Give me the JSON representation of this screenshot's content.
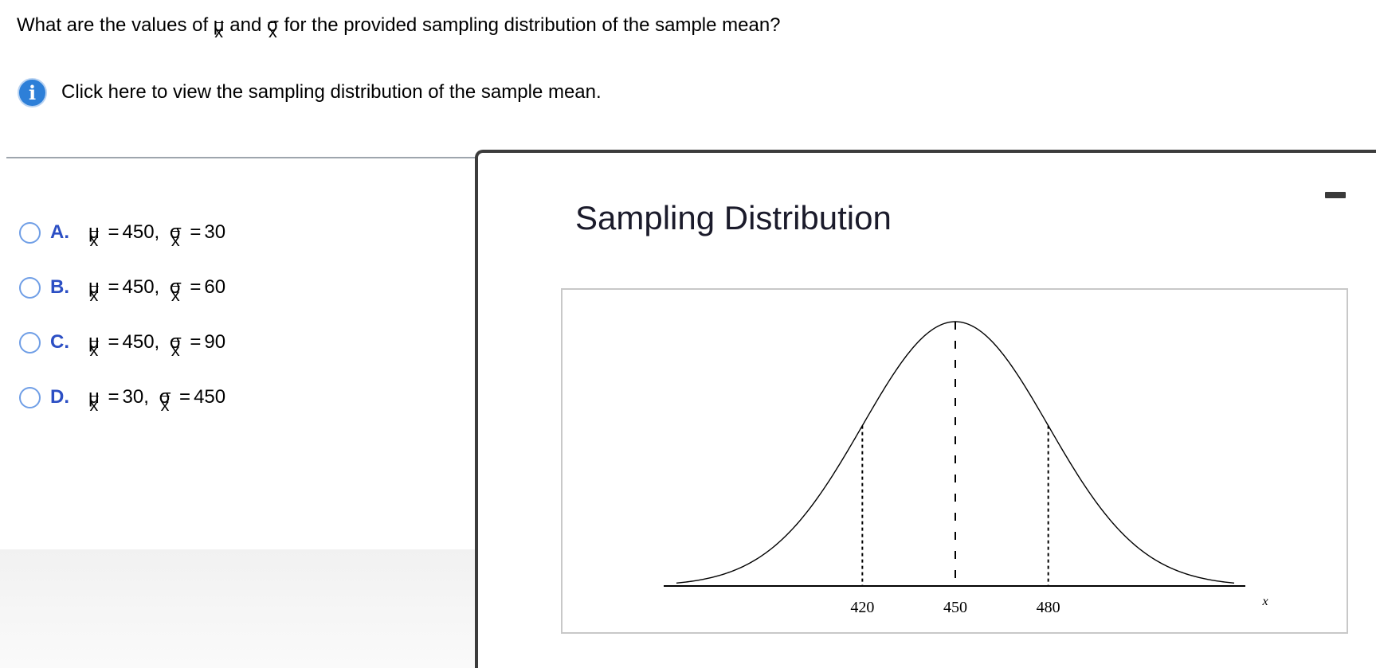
{
  "question": {
    "prefix": "What are the values of ",
    "mu": "μ",
    "sigma": "σ",
    "sub": "x",
    "mid": " and ",
    "suffix": " for the provided sampling distribution of the sample mean?"
  },
  "info": {
    "icon": "info-icon",
    "icon_glyph": "i",
    "link_text": "Click here to view the sampling distribution of the sample mean."
  },
  "options": [
    {
      "letter": "A.",
      "mu_value": "450,",
      "sigma_value": "30"
    },
    {
      "letter": "B.",
      "mu_value": "450,",
      "sigma_value": "60"
    },
    {
      "letter": "C.",
      "mu_value": "450,",
      "sigma_value": "90"
    },
    {
      "letter": "D.",
      "mu_value": "30,",
      "sigma_value": "450"
    }
  ],
  "symbols": {
    "mu": "μ",
    "sigma": "σ",
    "sub": "x",
    "equals": "="
  },
  "popup": {
    "title": "Sampling Distribution",
    "minimize_icon": "minimize-icon"
  },
  "chart_data": {
    "type": "line",
    "distribution": "normal",
    "mean": 450,
    "sd": 30,
    "xlim": [
      360,
      540
    ],
    "x_ticks": [
      420,
      450,
      480
    ],
    "tick_labels": [
      "420",
      "450",
      "480"
    ],
    "xlabel": "x",
    "markers": [
      420,
      450,
      480
    ]
  },
  "colors": {
    "accent": "#2c4fc4",
    "radio_border": "#6f9ee6",
    "info_icon": "#2d7fd8"
  }
}
